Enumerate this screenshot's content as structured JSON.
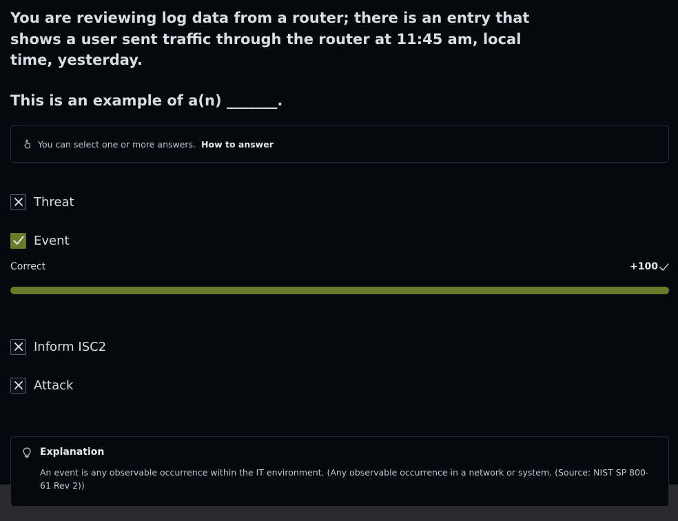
{
  "question": {
    "text": "You are reviewing log data from a router; there is an entry that shows a user sent traffic through the router at 11:45 am, local time, yesterday.",
    "prompt": "This is an example of a(n) _______."
  },
  "hint": {
    "icon": "hand-pointer-icon",
    "text": "You can select one or more answers.",
    "link": "How to answer"
  },
  "options": [
    {
      "label": "Threat",
      "state": "unselected",
      "icon": "x-mark-icon"
    },
    {
      "label": "Event",
      "state": "checked",
      "icon": "checkmark-icon"
    },
    {
      "label": "Inform ISC2",
      "state": "unselected",
      "icon": "x-mark-icon"
    },
    {
      "label": "Attack",
      "state": "unselected",
      "icon": "x-mark-icon"
    }
  ],
  "result": {
    "label": "Correct",
    "score": "+100",
    "progress_percent": 100
  },
  "explanation": {
    "icon": "lightbulb-icon",
    "title": "Explanation",
    "body": "An event is any observable occurrence within the IT environment. (Any observable occurrence in a network or system. (Source: NIST SP 800-61 Rev 2))"
  },
  "colors": {
    "background": "#05080f",
    "accent": "#6b7a2a",
    "border": "#232833",
    "text": "#d9dde3"
  }
}
